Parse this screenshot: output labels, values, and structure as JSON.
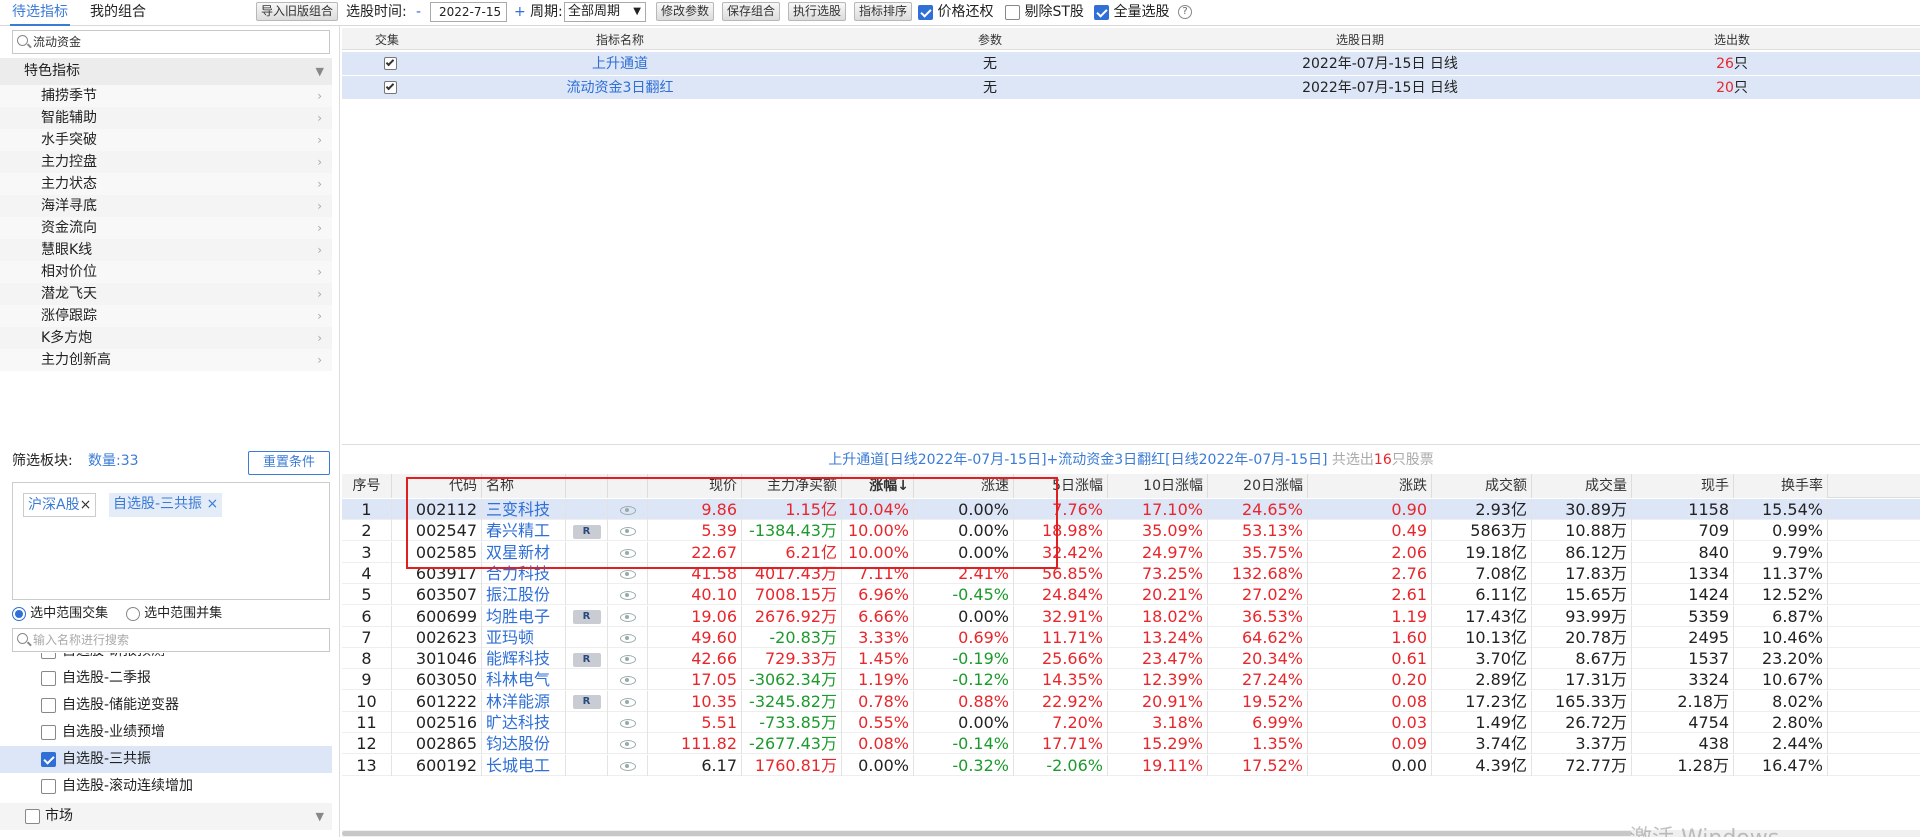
{
  "tabs": {
    "screening": "待选指标",
    "my_combo": "我的组合"
  },
  "toolbar": {
    "import_label": "导入旧版组合",
    "date_label": "选股时间:",
    "minus": "-",
    "date_value": "2022-7-15",
    "plus": "+",
    "period_label": "周期:",
    "period_value": "全部周期",
    "modify_label": "修改参数",
    "save_label": "保存组合",
    "execute_label": "执行选股",
    "sort_label": "指标排序",
    "price_adjust_label": "价格还权",
    "exclude_st_label": "剔除ST股",
    "full_select_label": "全量选股",
    "help": "?"
  },
  "sidebar": {
    "search_value": "流动资金",
    "section_title": "特色指标",
    "items": [
      "捕捞季节",
      "智能辅助",
      "水手突破",
      "主力控盘",
      "主力状态",
      "海洋寻底",
      "资金流向",
      "慧眼K线",
      "相对价位",
      "潜龙飞天",
      "涨停跟踪",
      "K多方炮",
      "主力创新高"
    ],
    "filter_label": "筛选板块:",
    "count_label": "数量:33",
    "reset_label": "重置条件",
    "chips": [
      "沪深A股",
      "自选股-三共振"
    ],
    "chip_close": "×",
    "radio_intersect": "选中范围交集",
    "radio_union": "选中范围并集",
    "search_placeholder": "输入名称进行搜索",
    "list": [
      "自选股-研报预测",
      "自选股-二季报",
      "自选股-储能逆变器",
      "自选股-业绩预增",
      "自选股-三共振",
      "自选股-滚动连续增加"
    ],
    "market_label": "市场"
  },
  "indicator_table": {
    "headers": [
      "交集",
      "指标名称",
      "参数",
      "选股日期",
      "选出数"
    ],
    "rows": [
      {
        "name": "上升通道",
        "param": "无",
        "date": "2022年-07月-15日 日线",
        "count": "26",
        "unit": "只"
      },
      {
        "name": "流动资金3日翻红",
        "param": "无",
        "date": "2022年-07月-15日 日线",
        "count": "20",
        "unit": "只"
      }
    ]
  },
  "summary": {
    "text": "上升通道[日线2022年-07月-15日]+流动资金3日翻红[日线2022年-07月-15日]",
    "prefix": "共选出",
    "count": "16",
    "suffix": "只股票"
  },
  "results": {
    "headers": [
      "序号",
      "代码",
      "名称",
      "",
      "",
      "现价",
      "主力净买额",
      "涨幅↓",
      "涨速",
      "5日涨幅",
      "10日涨幅",
      "20日涨幅",
      "涨跌",
      "成交额",
      "成交量",
      "现手",
      "换手率"
    ],
    "rows": [
      {
        "no": "1",
        "code": "002112",
        "name": "三变科技",
        "r": false,
        "price": "9.86",
        "net": "1.15亿",
        "chg": "10.04%",
        "speed": "0.00%",
        "d5": "7.76%",
        "d10": "17.10%",
        "d20": "24.65%",
        "diff": "0.90",
        "amount": "2.93亿",
        "vol": "30.89万",
        "hand": "1158",
        "turnover": "15.54%"
      },
      {
        "no": "2",
        "code": "002547",
        "name": "春兴精工",
        "r": true,
        "price": "5.39",
        "net": "-1384.43万",
        "chg": "10.00%",
        "speed": "0.00%",
        "d5": "18.98%",
        "d10": "35.09%",
        "d20": "53.13%",
        "diff": "0.49",
        "amount": "5863万",
        "vol": "10.88万",
        "hand": "709",
        "turnover": "0.99%"
      },
      {
        "no": "3",
        "code": "002585",
        "name": "双星新材",
        "r": false,
        "price": "22.67",
        "net": "6.21亿",
        "chg": "10.00%",
        "speed": "0.00%",
        "d5": "32.42%",
        "d10": "24.97%",
        "d20": "35.75%",
        "diff": "2.06",
        "amount": "19.18亿",
        "vol": "86.12万",
        "hand": "840",
        "turnover": "9.79%"
      },
      {
        "no": "4",
        "code": "603917",
        "name": "合力科技",
        "r": false,
        "price": "41.58",
        "net": "4017.43万",
        "chg": "7.11%",
        "speed": "2.41%",
        "d5": "56.85%",
        "d10": "73.25%",
        "d20": "132.68%",
        "diff": "2.76",
        "amount": "7.08亿",
        "vol": "17.83万",
        "hand": "1334",
        "turnover": "11.37%"
      },
      {
        "no": "5",
        "code": "603507",
        "name": "振江股份",
        "r": false,
        "price": "40.10",
        "net": "7008.15万",
        "chg": "6.96%",
        "speed": "-0.45%",
        "d5": "24.84%",
        "d10": "20.21%",
        "d20": "27.02%",
        "diff": "2.61",
        "amount": "6.11亿",
        "vol": "15.65万",
        "hand": "1424",
        "turnover": "12.52%"
      },
      {
        "no": "6",
        "code": "600699",
        "name": "均胜电子",
        "r": true,
        "price": "19.06",
        "net": "2676.92万",
        "chg": "6.66%",
        "speed": "0.00%",
        "d5": "32.91%",
        "d10": "18.02%",
        "d20": "36.53%",
        "diff": "1.19",
        "amount": "17.43亿",
        "vol": "93.99万",
        "hand": "5359",
        "turnover": "6.87%"
      },
      {
        "no": "7",
        "code": "002623",
        "name": "亚玛顿",
        "r": false,
        "price": "49.60",
        "net": "-20.83万",
        "chg": "3.33%",
        "speed": "0.69%",
        "d5": "11.71%",
        "d10": "13.24%",
        "d20": "64.62%",
        "diff": "1.60",
        "amount": "10.13亿",
        "vol": "20.78万",
        "hand": "2495",
        "turnover": "10.46%"
      },
      {
        "no": "8",
        "code": "301046",
        "name": "能辉科技",
        "r": true,
        "price": "42.66",
        "net": "729.33万",
        "chg": "1.45%",
        "speed": "-0.19%",
        "d5": "25.66%",
        "d10": "23.47%",
        "d20": "20.34%",
        "diff": "0.61",
        "amount": "3.70亿",
        "vol": "8.67万",
        "hand": "1537",
        "turnover": "23.20%"
      },
      {
        "no": "9",
        "code": "603050",
        "name": "科林电气",
        "r": false,
        "price": "17.05",
        "net": "-3062.34万",
        "chg": "1.19%",
        "speed": "-0.12%",
        "d5": "14.35%",
        "d10": "12.39%",
        "d20": "27.24%",
        "diff": "0.20",
        "amount": "2.89亿",
        "vol": "17.31万",
        "hand": "3324",
        "turnover": "10.67%"
      },
      {
        "no": "10",
        "code": "601222",
        "name": "林洋能源",
        "r": true,
        "price": "10.35",
        "net": "-3245.82万",
        "chg": "0.78%",
        "speed": "0.88%",
        "d5": "22.92%",
        "d10": "20.91%",
        "d20": "19.52%",
        "diff": "0.08",
        "amount": "17.23亿",
        "vol": "165.33万",
        "hand": "2.18万",
        "turnover": "8.02%"
      },
      {
        "no": "11",
        "code": "002516",
        "name": "旷达科技",
        "r": false,
        "price": "5.51",
        "net": "-733.85万",
        "chg": "0.55%",
        "speed": "0.00%",
        "d5": "7.20%",
        "d10": "3.18%",
        "d20": "6.99%",
        "diff": "0.03",
        "amount": "1.49亿",
        "vol": "26.72万",
        "hand": "4754",
        "turnover": "2.80%"
      },
      {
        "no": "12",
        "code": "002865",
        "name": "钧达股份",
        "r": false,
        "price": "111.82",
        "net": "-2677.43万",
        "chg": "0.08%",
        "speed": "-0.14%",
        "d5": "17.71%",
        "d10": "15.29%",
        "d20": "1.35%",
        "diff": "0.09",
        "amount": "3.74亿",
        "vol": "3.37万",
        "hand": "438",
        "turnover": "2.44%"
      },
      {
        "no": "13",
        "code": "600192",
        "name": "长城电工",
        "r": false,
        "price": "6.17",
        "net": "1760.81万",
        "chg": "0.00%",
        "speed": "-0.32%",
        "d5": "-2.06%",
        "d10": "19.11%",
        "d20": "17.52%",
        "diff": "0.00",
        "amount": "4.39亿",
        "vol": "72.77万",
        "hand": "1.28万",
        "turnover": "16.47%"
      }
    ]
  },
  "watermark": "激活 Windows",
  "colors": {
    "accent": "#3b7bd6",
    "up": "#e8262b",
    "down": "#1c9a2c",
    "highlight_box": "#e02020",
    "selected_row": "#dce6f6"
  }
}
